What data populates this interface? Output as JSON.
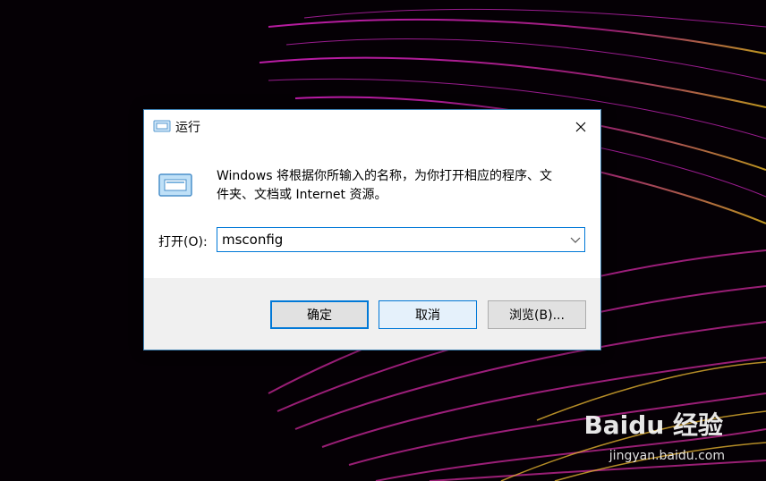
{
  "dialog": {
    "title": "运行",
    "description_line1": "Windows 将根据你所输入的名称，为你打开相应的程序、文",
    "description_line2": "件夹、文档或 Internet 资源。",
    "open_label": "打开(O):",
    "input_value": "msconfig",
    "buttons": {
      "ok": "确定",
      "cancel": "取消",
      "browse": "浏览(B)..."
    }
  },
  "icons": [
    "run-icon",
    "close-icon",
    "chevron-down-icon"
  ],
  "watermark": {
    "logo_text": "Baidu 经验",
    "url": "jingyan.baidu.com"
  },
  "colors": {
    "accent": "#0078d7",
    "footer": "#f0f0f0"
  }
}
